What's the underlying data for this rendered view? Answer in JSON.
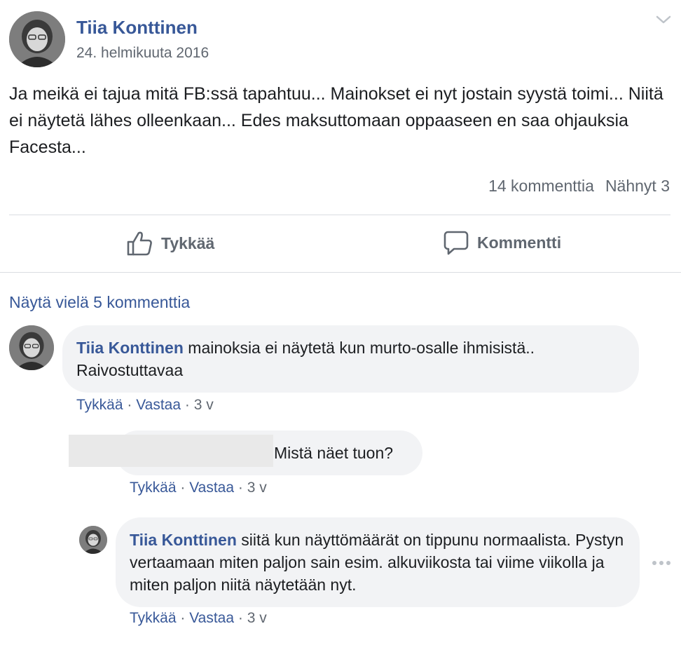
{
  "post": {
    "author": "Tiia Konttinen",
    "date": "24. helmikuuta 2016",
    "text": "Ja meikä ei tajua mitä FB:ssä tapahtuu... Mainokset ei nyt jostain syystä toimi... Niitä ei näytetä lähes olleenkaan... Edes maksuttomaan oppaaseen en saa ohjauksia Facesta...",
    "comments_count": "14 kommenttia",
    "seen": "Nähnyt 3"
  },
  "actions": {
    "like": "Tykkää",
    "comment": "Kommentti"
  },
  "more_comments": "Näytä vielä 5 kommenttia",
  "comments": [
    {
      "author": "Tiia Konttinen",
      "text": "mainoksia ei näytetä kun murto-osalle ihmisistä.. Raivostuttavaa",
      "like": "Tykkää",
      "reply": "Vastaa",
      "time": "3 v"
    },
    {
      "author": "",
      "text": "Mistä näet tuon?",
      "like": "Tykkää",
      "reply": "Vastaa",
      "time": "3 v"
    },
    {
      "author": "Tiia Konttinen",
      "text": "siitä kun näyttömäärät on tippunu normaalista. Pystyn vertaamaan miten paljon sain esim. alkuviikosta tai viime viikolla ja miten paljon niitä näytetään nyt.",
      "like": "Tykkää",
      "reply": "Vastaa",
      "time": "3 v"
    }
  ],
  "separator": "·",
  "colors": {
    "link": "#385898",
    "secondary_text": "#606770",
    "bubble_bg": "#f2f3f5",
    "divider": "#dadde1"
  },
  "icons": {
    "like": "thumbs-up-icon",
    "comment": "speech-bubble-icon",
    "menu": "chevron-down-icon",
    "more": "ellipsis-icon"
  }
}
